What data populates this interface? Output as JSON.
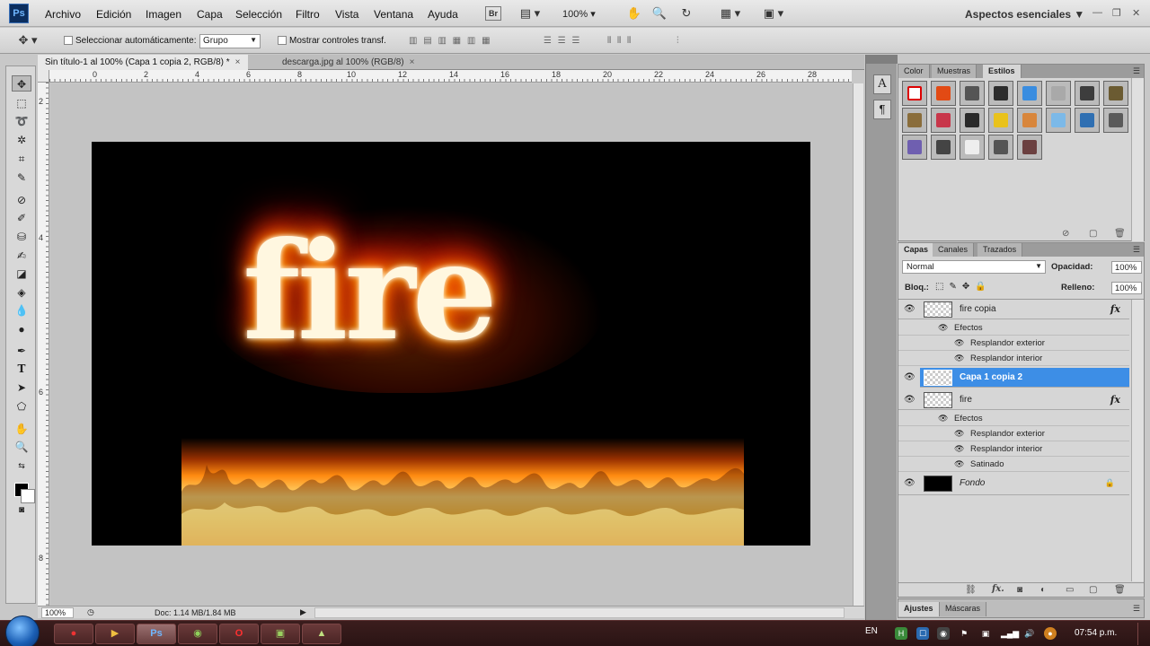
{
  "app": {
    "logo": "Ps",
    "workspace": "Aspectos esenciales ▼",
    "zoom_label": "100%"
  },
  "menu": [
    "Archivo",
    "Edición",
    "Imagen",
    "Capa",
    "Selección",
    "Filtro",
    "Vista",
    "Ventana",
    "Ayuda"
  ],
  "toolbar_icons": {
    "bridge": "Br",
    "minibridge": "▤",
    "zoom": "100%"
  },
  "options": {
    "auto_select_label": "Seleccionar automáticamente:",
    "auto_select_value": "Grupo",
    "transform_label": "Mostrar controles transf."
  },
  "doc_tabs": [
    {
      "label": "Sin título-1 al 100% (Capa 1 copia 2, RGB/8) *",
      "close": "×"
    },
    {
      "label": "descarga.jpg al 100% (RGB/8)",
      "close": "×"
    }
  ],
  "ruler": {
    "top": [
      "0",
      "2",
      "4",
      "6",
      "8",
      "10",
      "12",
      "14",
      "16",
      "18",
      "20",
      "22",
      "24",
      "26",
      "28"
    ],
    "left": [
      "2",
      "4",
      "6",
      "8"
    ]
  },
  "canvas": {
    "text": "fire"
  },
  "status": {
    "zoom": "100%",
    "doc": "Doc: 1.14 MB/1.84 MB"
  },
  "panels": {
    "top_tabs": [
      "Color",
      "Muestras",
      "Estilos"
    ],
    "layer_tabs": [
      "Capas",
      "Canales",
      "Trazados"
    ],
    "blend_mode": "Normal",
    "opacity_label": "Opacidad:",
    "opacity": "100%",
    "lock_label": "Bloq.:",
    "fill_label": "Relleno:",
    "fill": "100%",
    "bottom_tabs": [
      "Ajustes",
      "Máscaras"
    ]
  },
  "styles_colors": [
    "#f0f0f0",
    "#e24a14",
    "#555555",
    "#2c2c2c",
    "#3a8de0",
    "#a9a9a9",
    "#3d3d3d",
    "#6b5b32",
    "#8a6d3b",
    "#c8364a",
    "#2a2a2a",
    "#e9c21c",
    "#d8863c",
    "#7cb9e8",
    "#2f6fb2",
    "#5a5a5a",
    "#6f5fb0",
    "#444444",
    "#eeeeee",
    "#555555",
    "#6b4040"
  ],
  "layers": [
    {
      "name": "fire copia",
      "fx": "fx",
      "effects_label": "Efectos",
      "effects": [
        "Resplandor exterior",
        "Resplandor interior"
      ]
    },
    {
      "name": "Capa 1 copia 2"
    },
    {
      "name": "fire",
      "fx": "fx",
      "effects_label": "Efectos",
      "effects": [
        "Resplandor exterior",
        "Resplandor interior",
        "Satinado"
      ]
    },
    {
      "name": "Fondo"
    }
  ],
  "taskbar": {
    "apps": [
      "●",
      "▶",
      "Ps",
      "◉",
      "O",
      "▣",
      "▲"
    ],
    "lang": "EN",
    "clock": "07:54 p.m."
  }
}
